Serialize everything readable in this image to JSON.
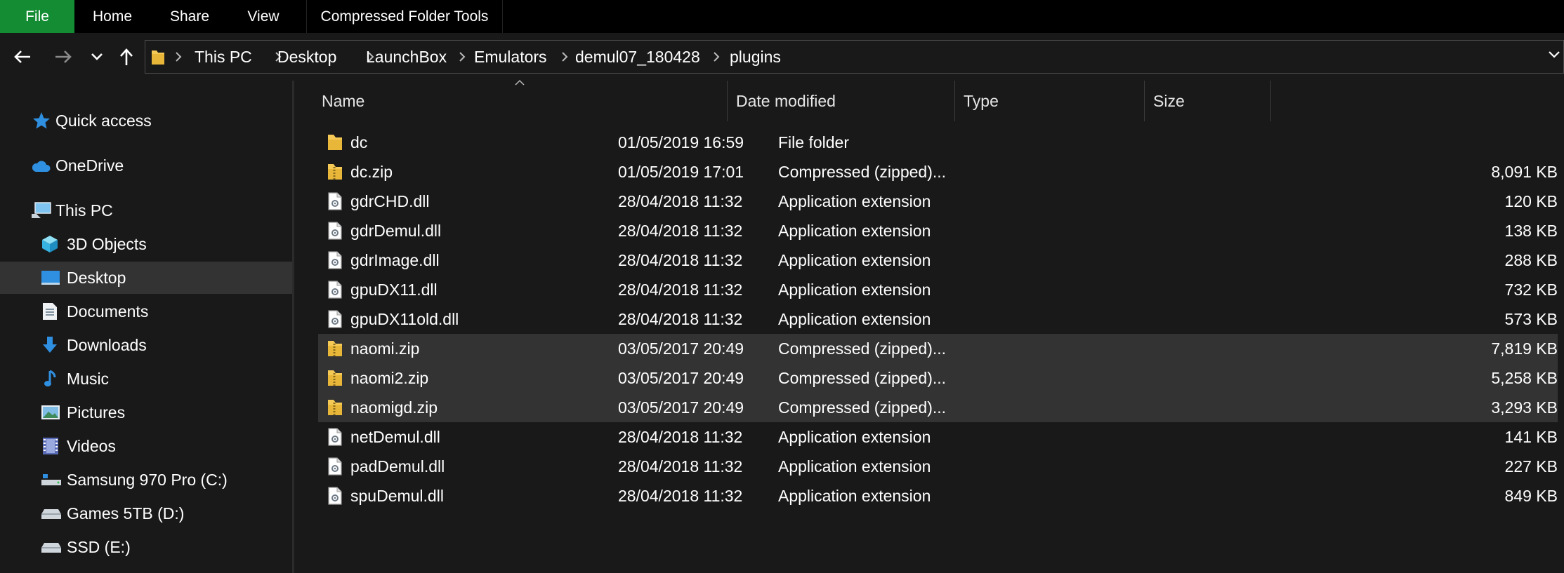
{
  "ribbon": {
    "tabs": [
      "File",
      "Home",
      "Share",
      "View",
      "Compressed Folder Tools"
    ]
  },
  "address": {
    "crumbs": [
      "This PC",
      "Desktop",
      "LaunchBox",
      "Emulators",
      "demul07_180428",
      "plugins"
    ]
  },
  "sidebar": {
    "items": [
      {
        "label": "Quick access",
        "icon": "star-icon"
      },
      {
        "label": "OneDrive",
        "icon": "cloud-icon"
      },
      {
        "label": "This PC",
        "icon": "computer-icon"
      },
      {
        "label": "3D Objects",
        "icon": "cube-icon"
      },
      {
        "label": "Desktop",
        "icon": "desktop-icon",
        "selected": true
      },
      {
        "label": "Documents",
        "icon": "document-icon"
      },
      {
        "label": "Downloads",
        "icon": "download-arrow-icon"
      },
      {
        "label": "Music",
        "icon": "music-note-icon"
      },
      {
        "label": "Pictures",
        "icon": "picture-icon"
      },
      {
        "label": "Videos",
        "icon": "film-icon"
      },
      {
        "label": "Samsung 970 Pro (C:)",
        "icon": "system-drive-icon"
      },
      {
        "label": "Games 5TB (D:)",
        "icon": "drive-icon"
      },
      {
        "label": "SSD (E:)",
        "icon": "drive-icon"
      }
    ]
  },
  "columns": {
    "name": "Name",
    "date": "Date modified",
    "type": "Type",
    "size": "Size"
  },
  "files": [
    {
      "name": "dc",
      "date": "01/05/2019 16:59",
      "type": "File folder",
      "size": "",
      "icon": "folder-icon",
      "selected": false
    },
    {
      "name": "dc.zip",
      "date": "01/05/2019 17:01",
      "type": "Compressed (zipped)...",
      "size": "8,091 KB",
      "icon": "zip-folder-icon",
      "selected": false
    },
    {
      "name": "gdrCHD.dll",
      "date": "28/04/2018 11:32",
      "type": "Application extension",
      "size": "120 KB",
      "icon": "dll-file-icon",
      "selected": false
    },
    {
      "name": "gdrDemul.dll",
      "date": "28/04/2018 11:32",
      "type": "Application extension",
      "size": "138 KB",
      "icon": "dll-file-icon",
      "selected": false
    },
    {
      "name": "gdrImage.dll",
      "date": "28/04/2018 11:32",
      "type": "Application extension",
      "size": "288 KB",
      "icon": "dll-file-icon",
      "selected": false
    },
    {
      "name": "gpuDX11.dll",
      "date": "28/04/2018 11:32",
      "type": "Application extension",
      "size": "732 KB",
      "icon": "dll-file-icon",
      "selected": false
    },
    {
      "name": "gpuDX11old.dll",
      "date": "28/04/2018 11:32",
      "type": "Application extension",
      "size": "573 KB",
      "icon": "dll-file-icon",
      "selected": false
    },
    {
      "name": "naomi.zip",
      "date": "03/05/2017 20:49",
      "type": "Compressed (zipped)...",
      "size": "7,819 KB",
      "icon": "zip-folder-icon",
      "selected": true
    },
    {
      "name": "naomi2.zip",
      "date": "03/05/2017 20:49",
      "type": "Compressed (zipped)...",
      "size": "5,258 KB",
      "icon": "zip-folder-icon",
      "selected": true
    },
    {
      "name": "naomigd.zip",
      "date": "03/05/2017 20:49",
      "type": "Compressed (zipped)...",
      "size": "3,293 KB",
      "icon": "zip-folder-icon",
      "selected": true
    },
    {
      "name": "netDemul.dll",
      "date": "28/04/2018 11:32",
      "type": "Application extension",
      "size": "141 KB",
      "icon": "dll-file-icon",
      "selected": false
    },
    {
      "name": "padDemul.dll",
      "date": "28/04/2018 11:32",
      "type": "Application extension",
      "size": "227 KB",
      "icon": "dll-file-icon",
      "selected": false
    },
    {
      "name": "spuDemul.dll",
      "date": "28/04/2018 11:32",
      "type": "Application extension",
      "size": "849 KB",
      "icon": "dll-file-icon",
      "selected": false
    }
  ],
  "colors": {
    "file_tab": "#138c33",
    "background": "#191919",
    "selection": "#333333",
    "folder": "#f5c955",
    "accent_blue": "#2f8fe0"
  }
}
